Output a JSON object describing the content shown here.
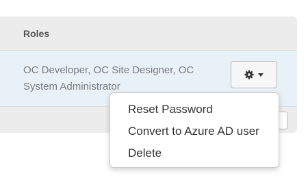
{
  "table": {
    "header": {
      "roles_label": "Roles"
    },
    "row": {
      "roles_value": "OC Developer, OC Site Designer, OC System Administrator",
      "actions_button": {
        "icon": "gear-icon",
        "caret": "chevron-down-icon"
      }
    }
  },
  "dropdown": {
    "items": [
      {
        "label": "Reset Password"
      },
      {
        "label": "Convert to Azure AD user"
      },
      {
        "label": "Delete"
      }
    ]
  },
  "colors": {
    "header_bg": "#ececec",
    "row_highlight": "#e9f1f8",
    "text_muted": "#7a7a7a",
    "text_dark": "#333333"
  }
}
